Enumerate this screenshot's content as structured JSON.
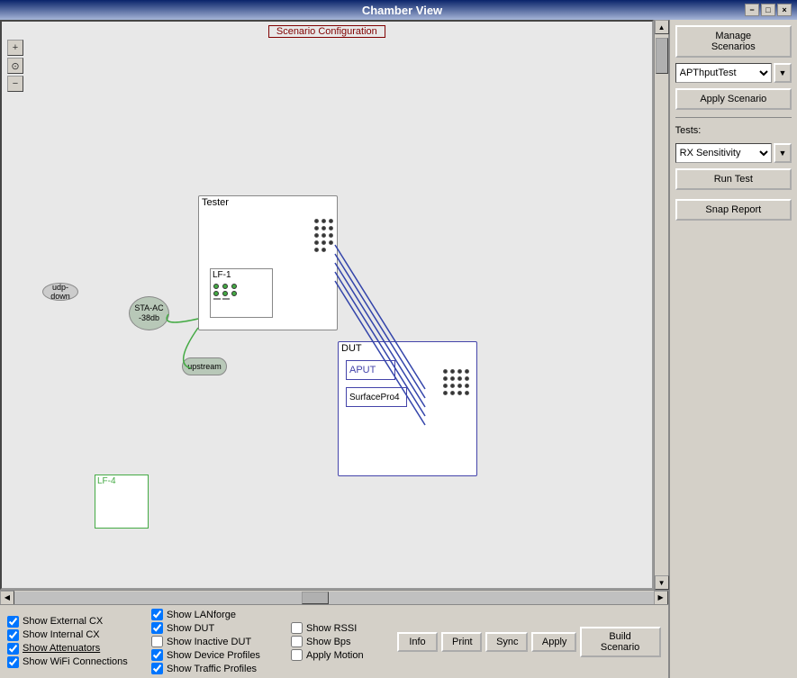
{
  "window": {
    "title": "Chamber View",
    "title_center": "Chamber View"
  },
  "titlebar": {
    "minimize": "−",
    "maximize": "□",
    "close": "×"
  },
  "canvas": {
    "scenario_config_label": "Scenario Configuration",
    "zoom_in": "+",
    "zoom_fit": "⊙",
    "zoom_out": "−",
    "nodes": {
      "tester_title": "Tester",
      "lf1_title": "LF-1",
      "dut_title": "DUT",
      "aput_label": "APUT",
      "surfacepro_label": "SurfacePro4",
      "lf4_title": "LF-4",
      "udp_down": "udp-down",
      "sta_ac": "STA-AC\n-38db",
      "upstream": "upstream"
    }
  },
  "right_panel": {
    "manage_scenarios_label": "Manage\nScenarios",
    "scenario_value": "APThputTest",
    "scenario_dropdown_arrow": "▼",
    "apply_scenario_label": "Apply Scenario",
    "tests_label": "Tests:",
    "test_value": "RX Sensitivity",
    "test_dropdown_arrow": "▼",
    "run_test_label": "Run Test",
    "snap_report_label": "Snap Report"
  },
  "bottom_controls": {
    "checkboxes": {
      "show_external_cx": {
        "label": "Show External CX",
        "checked": true
      },
      "show_internal_cx": {
        "label": "Show Internal CX",
        "checked": true
      },
      "show_attenuators": {
        "label": "Show Attenuators",
        "checked": true,
        "underline": true
      },
      "show_wifi_connections": {
        "label": "Show WiFi Connections",
        "checked": true
      },
      "show_lanforge": {
        "label": "Show LANforge",
        "checked": true
      },
      "show_dut": {
        "label": "Show DUT",
        "checked": true
      },
      "show_inactive_dut": {
        "label": "Show Inactive DUT",
        "checked": false
      },
      "show_device_profiles": {
        "label": "Show Device Profiles",
        "checked": true
      },
      "show_traffic_profiles": {
        "label": "Show Traffic Profiles",
        "checked": true
      },
      "show_rssi": {
        "label": "Show RSSI",
        "checked": false
      },
      "show_bps": {
        "label": "Show Bps",
        "checked": false
      },
      "apply_motion": {
        "label": "Apply Motion",
        "checked": false
      }
    },
    "buttons": {
      "info": "Info",
      "print": "Print",
      "sync": "Sync",
      "apply": "Apply",
      "build_scenario": "Build Scenario"
    }
  }
}
